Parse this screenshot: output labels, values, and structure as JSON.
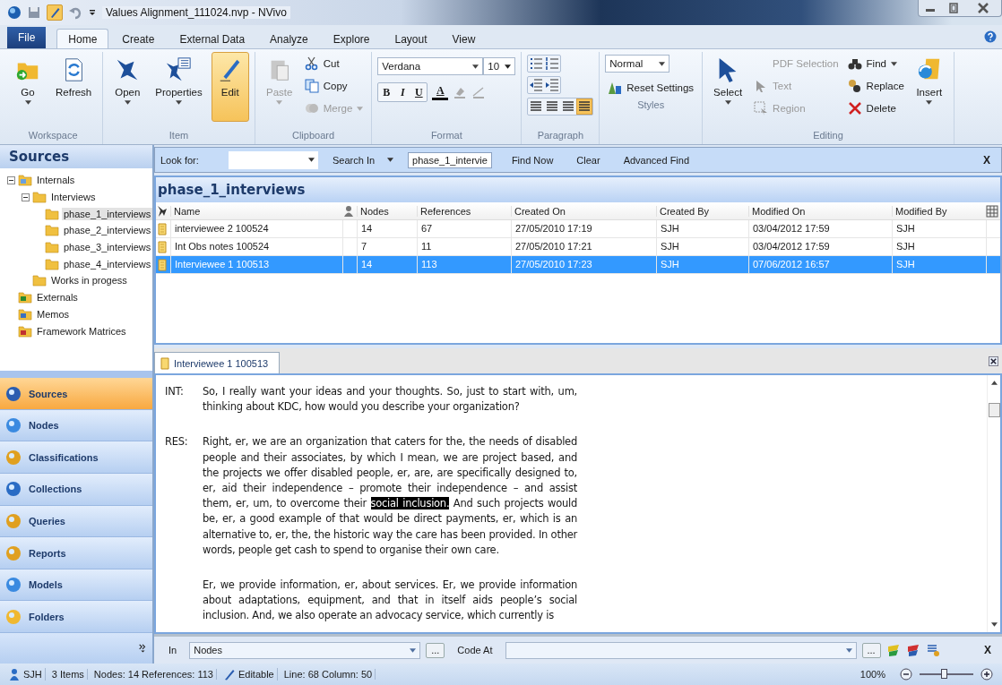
{
  "window": {
    "title": "Values Alignment_111024.nvp - NVivo"
  },
  "menu_tabs": [
    {
      "label": "File",
      "kind": "file",
      "selected": false
    },
    {
      "label": "Home",
      "kind": "tab",
      "selected": true
    },
    {
      "label": "Create",
      "kind": "tab",
      "selected": false
    },
    {
      "label": "External Data",
      "kind": "tab",
      "selected": false
    },
    {
      "label": "Analyze",
      "kind": "tab",
      "selected": false
    },
    {
      "label": "Explore",
      "kind": "tab",
      "selected": false
    },
    {
      "label": "Layout",
      "kind": "tab",
      "selected": false
    },
    {
      "label": "View",
      "kind": "tab",
      "selected": false
    }
  ],
  "ribbon": {
    "workspace": {
      "label": "Workspace",
      "go": "Go",
      "refresh": "Refresh"
    },
    "item": {
      "label": "Item",
      "open": "Open",
      "properties": "Properties",
      "edit": {
        "label": "Edit",
        "selected": true
      }
    },
    "clipboard": {
      "label": "Clipboard",
      "paste": {
        "label": "Paste",
        "disabled": true
      },
      "cut": {
        "label": "Cut",
        "disabled": false
      },
      "copy": {
        "label": "Copy",
        "disabled": false
      },
      "merge": {
        "label": "Merge",
        "disabled": true
      }
    },
    "format": {
      "label": "Format",
      "font": "Verdana",
      "size": "10",
      "bold": "B",
      "italic": "I",
      "underline": "U",
      "font_color": "A"
    },
    "paragraph": {
      "label": "Paragraph",
      "alignments": [
        {
          "selected": false
        },
        {
          "selected": false
        },
        {
          "selected": false
        },
        {
          "selected": true
        }
      ]
    },
    "styles": {
      "label": "Styles",
      "style": "Normal",
      "reset": "Reset Settings"
    },
    "editing": {
      "label": "Editing",
      "select": "Select",
      "pdf": {
        "label": "PDF Selection",
        "disabled": true
      },
      "text": {
        "label": "Text",
        "disabled": true
      },
      "region": {
        "label": "Region",
        "disabled": true
      },
      "find": "Find",
      "replace": "Replace",
      "delete": "Delete",
      "insert": "Insert"
    }
  },
  "sidebar": {
    "title": "Sources",
    "tree": [
      {
        "label": "Internals",
        "expanded": true,
        "selected": false,
        "children": [
          {
            "label": "Interviews",
            "expanded": true,
            "selected": false,
            "children": [
              {
                "label": "phase_1_interviews",
                "selected": true
              },
              {
                "label": "phase_2_interviews",
                "selected": false
              },
              {
                "label": "phase_3_interviews",
                "selected": false
              },
              {
                "label": "phase_4_interviews",
                "selected": false
              }
            ]
          },
          {
            "label": "Works in progess",
            "selected": false
          }
        ]
      },
      {
        "label": "Externals",
        "selected": false
      },
      {
        "label": "Memos",
        "selected": false
      },
      {
        "label": "Framework Matrices",
        "selected": false
      }
    ],
    "nav": [
      {
        "label": "Sources",
        "selected": true
      },
      {
        "label": "Nodes",
        "selected": false
      },
      {
        "label": "Classifications",
        "selected": false
      },
      {
        "label": "Collections",
        "selected": false
      },
      {
        "label": "Queries",
        "selected": false
      },
      {
        "label": "Reports",
        "selected": false
      },
      {
        "label": "Models",
        "selected": false
      },
      {
        "label": "Folders",
        "selected": false
      }
    ]
  },
  "find_bar": {
    "look_for": "Look for:",
    "search_in": "Search In",
    "search_in_value": "phase_1_intervie",
    "find_now": "Find Now",
    "clear": "Clear",
    "advanced_find": "Advanced Find",
    "close": "X"
  },
  "list": {
    "title": "phase_1_interviews",
    "columns": [
      "Name",
      "Nodes",
      "References",
      "Created On",
      "Created By",
      "Modified On",
      "Modified By"
    ],
    "rows": [
      {
        "cells": [
          "interviewee 2 100524",
          "14",
          "67",
          "27/05/2010 17:19",
          "SJH",
          "03/04/2012 17:59",
          "SJH"
        ],
        "selected": false
      },
      {
        "cells": [
          "Int Obs notes 100524",
          "7",
          "11",
          "27/05/2010 17:21",
          "SJH",
          "03/04/2012 17:59",
          "SJH"
        ],
        "selected": false
      },
      {
        "cells": [
          "Interviewee 1 100513",
          "14",
          "113",
          "27/05/2010 17:23",
          "SJH",
          "07/06/2012 16:57",
          "SJH"
        ],
        "selected": true
      }
    ]
  },
  "document": {
    "tab": "Interviewee 1 100513",
    "paragraphs": [
      {
        "speaker": "INT:",
        "parts": [
          {
            "text": "So, I really want your ideas and your thoughts.  So, just to start with, um, thinking about KDC, how would you describe your organization?",
            "highlighted": false
          }
        ]
      },
      {
        "speaker": "RES:",
        "parts": [
          {
            "text": "Right, er, we are an organization that caters for the, the needs of disabled people and their associates, by which I mean, we are project based, and the projects we offer disabled people, er, are, are specifically designed to, er, aid their independence – promote their independence – and assist them, er, um, to overcome their ",
            "highlighted": false
          },
          {
            "text": "social inclusion.",
            "highlighted": true
          },
          {
            "text": " And such projects would be, er, a good example of that would be direct payments, er, which is an alternative to, er, the, the historic way the care has been provided.  In other words, people get cash to spend to organise their own care.",
            "highlighted": false
          }
        ]
      },
      {
        "parts": [
          {
            "text": "Er, we provide information, er, about services.  Er, we provide information about adaptations, equipment, and that in itself aids people’s social inclusion.  And, we also operate an advocacy service, which currently is",
            "highlighted": false
          }
        ]
      }
    ]
  },
  "code_bar": {
    "in_label": "In",
    "in_value": "Nodes",
    "browse": "...",
    "code_at": "Code At",
    "browse_2": "...",
    "close": "X"
  },
  "status_bar": {
    "user": "SJH",
    "items": "3 Items",
    "counts": "Nodes: 14  References: 113",
    "mode": "Editable",
    "position": "Line: 68 Column: 50",
    "zoom": "100%",
    "zoom_slider": {
      "level": 0.47
    }
  }
}
